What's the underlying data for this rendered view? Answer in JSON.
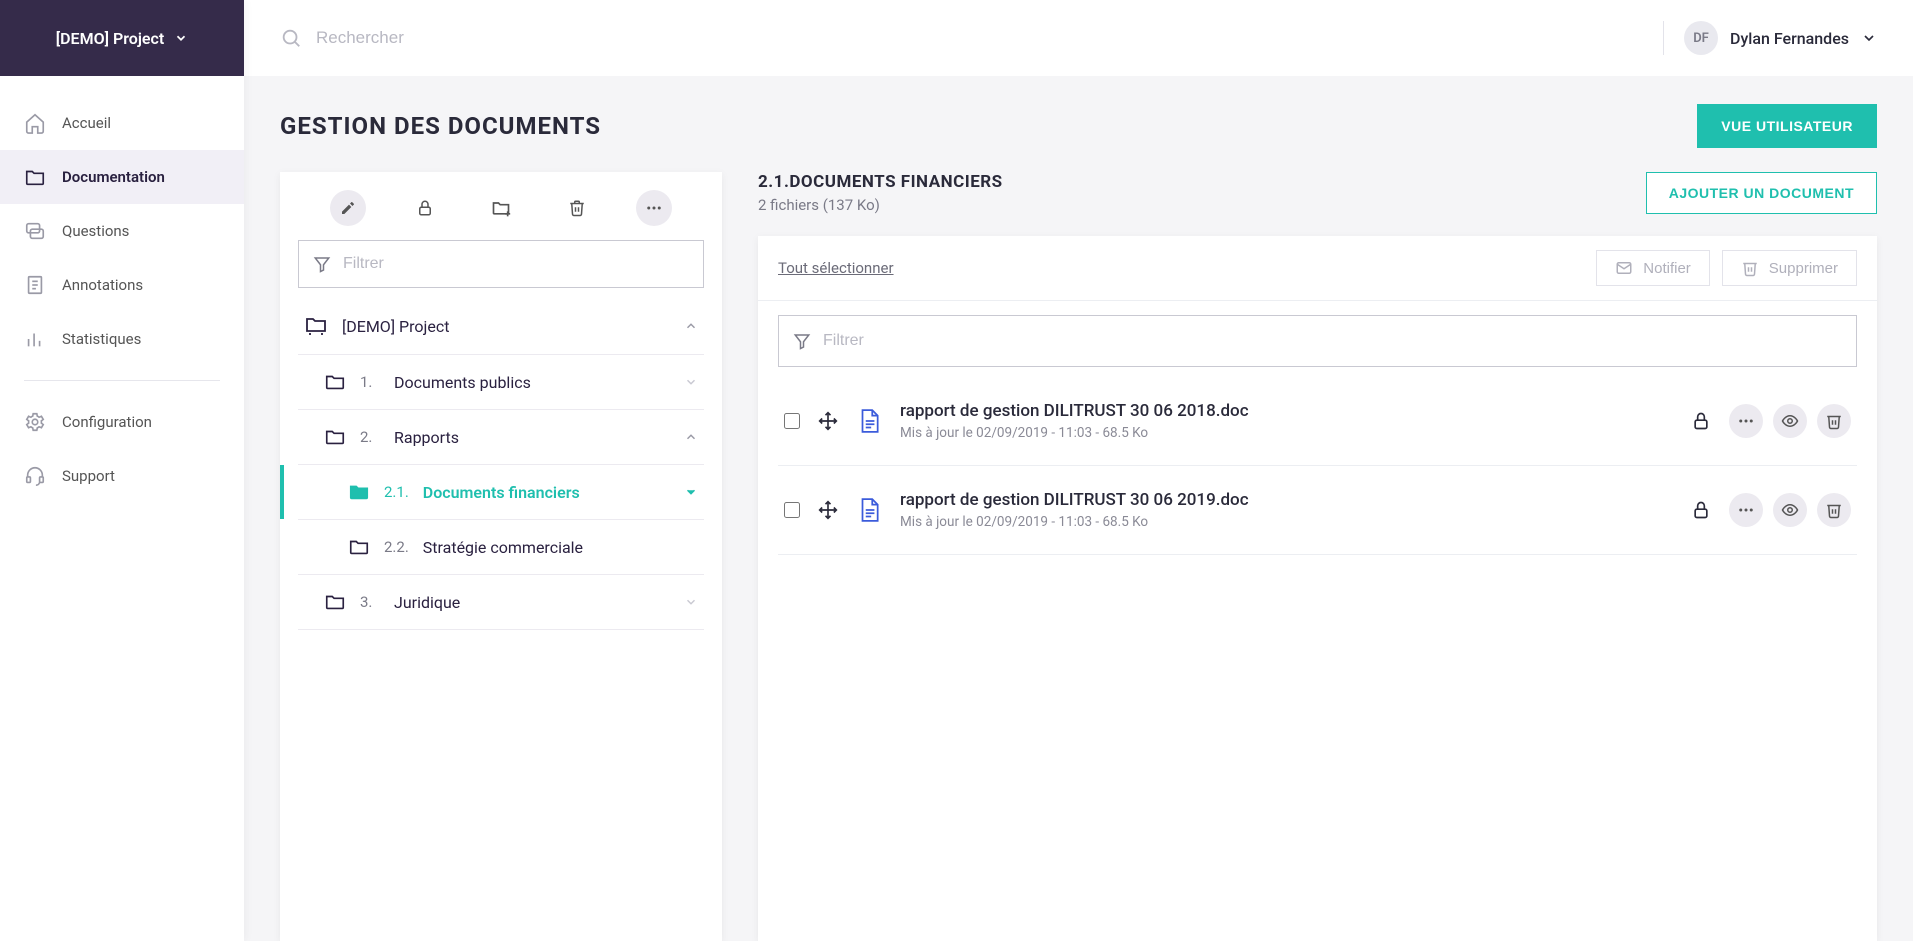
{
  "project_switch": {
    "label": "[DEMO] Project"
  },
  "nav": {
    "accueil": "Accueil",
    "documentation": "Documentation",
    "questions": "Questions",
    "annotations": "Annotations",
    "statistiques": "Statistiques",
    "configuration": "Configuration",
    "support": "Support"
  },
  "topbar": {
    "search_placeholder": "Rechercher",
    "user_initials": "DF",
    "user_name": "Dylan Fernandes"
  },
  "page": {
    "title": "GESTION DES DOCUMENTS",
    "view_user_btn": "VUE UTILISATEUR"
  },
  "tree": {
    "filter_placeholder": "Filtrer",
    "root": {
      "label": "[DEMO] Project"
    },
    "items": [
      {
        "num": "1.",
        "label": "Documents publics"
      },
      {
        "num": "2.",
        "label": "Rapports"
      },
      {
        "num": "2.1.",
        "label": "Documents financiers"
      },
      {
        "num": "2.2.",
        "label": "Stratégie commerciale"
      },
      {
        "num": "3.",
        "label": "Juridique"
      }
    ]
  },
  "docs": {
    "crumb": "2.1.DOCUMENTS FINANCIERS",
    "meta": "2 fichiers (137 Ko)",
    "add_btn": "AJOUTER UN DOCUMENT",
    "select_all": "Tout sélectionner",
    "notify_btn": "Notifier",
    "delete_btn": "Supprimer",
    "filter_placeholder": "Filtrer",
    "rows": [
      {
        "name": "rapport de gestion DILITRUST 30 06 2018.doc",
        "meta": "Mis à jour le 02/09/2019 - 11:03 - 68.5 Ko"
      },
      {
        "name": "rapport de gestion DILITRUST 30 06 2019.doc",
        "meta": "Mis à jour le 02/09/2019 - 11:03 - 68.5 Ko"
      }
    ]
  }
}
